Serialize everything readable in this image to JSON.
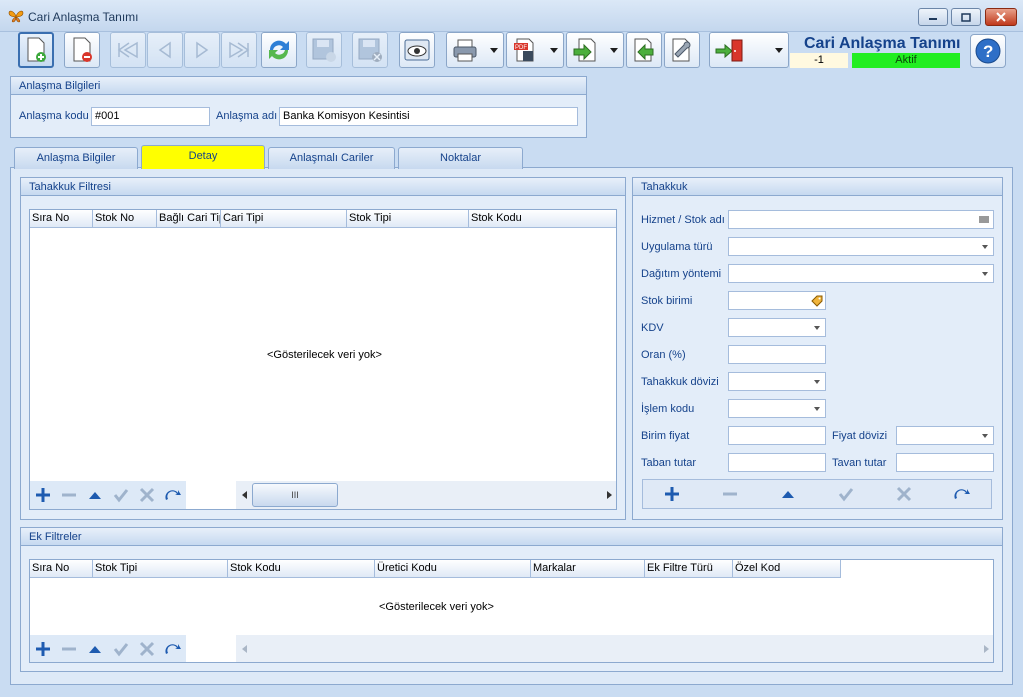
{
  "window": {
    "title": "Cari Anlaşma Tanımı"
  },
  "header": {
    "form_title": "Cari Anlaşma Tanımı",
    "record_no": "-1",
    "status": "Aktif"
  },
  "agreement_info": {
    "title": "Anlaşma Bilgileri",
    "code_label": "Anlaşma kodu",
    "code_value": "#001",
    "name_label": "Anlaşma adı",
    "name_value": "Banka Komisyon Kesintisi"
  },
  "tabs": [
    {
      "label": "Anlaşma Bilgiler"
    },
    {
      "label": "Detay"
    },
    {
      "label": "Anlaşmalı Cariler"
    },
    {
      "label": "Noktalar"
    }
  ],
  "accrual_filter": {
    "title": "Tahakkuk Filtresi",
    "columns": [
      "Sıra No",
      "Stok No",
      "Bağlı Cari Tipi",
      "Cari Tipi",
      "Stok Tipi",
      "Stok Kodu"
    ],
    "empty_text": "<Gösterilecek veri yok>",
    "scroll_thumb": "III"
  },
  "accrual": {
    "title": "Tahakkuk",
    "service_label": "Hizmet / Stok adı",
    "application_label": "Uygulama türü",
    "distribution_label": "Dağıtım yöntemi",
    "unit_label": "Stok birimi",
    "vat_label": "KDV",
    "rate_label": "Oran (%)",
    "currency_label": "Tahakkuk dövizi",
    "transaction_label": "İşlem kodu",
    "unit_price_label": "Birim fiyat",
    "price_currency_label": "Fiyat dövizi",
    "floor_label": "Taban tutar",
    "ceiling_label": "Tavan tutar"
  },
  "extra_filters": {
    "title": "Ek Filtreler",
    "columns": [
      "Sıra No",
      "Stok Tipi",
      "Stok Kodu",
      "Üretici Kodu",
      "Markalar",
      "Ek Filtre Türü",
      "Özel Kod"
    ],
    "empty_text": "<Gösterilecek veri yok>"
  },
  "icons": {
    "nav": [
      "add-icon",
      "remove-icon",
      "up-icon",
      "confirm-icon",
      "cancel-icon",
      "refresh-icon"
    ]
  },
  "colors": {
    "accent": "#15428b",
    "selected_tab": "#ffff00",
    "status_active": "#22ee22"
  }
}
